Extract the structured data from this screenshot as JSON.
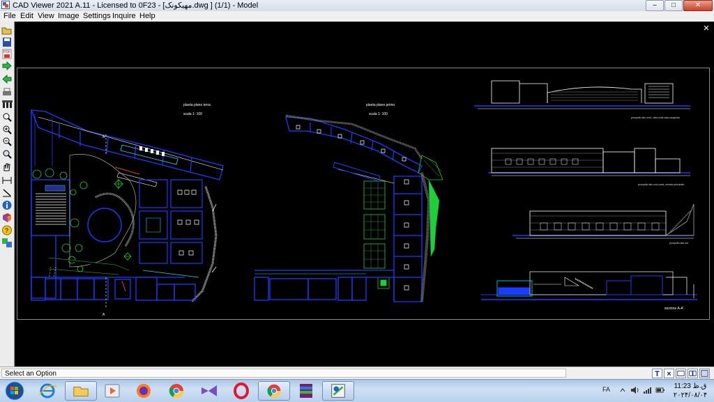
{
  "window": {
    "title": "CAD Viewer 2021 A.11 - Licensed to 0F23 - [مهیکونک.dwg ] (1/1) - Model",
    "min_label": "–",
    "max_label": "□",
    "close_label": "✕"
  },
  "menu": [
    "File",
    "Edit",
    "View",
    "Image",
    "Settings",
    "Inquire",
    "Help"
  ],
  "toolbar": {
    "pdf_label": "PDF",
    "close_drawing_label": "x"
  },
  "drawing": {
    "plan1_title": "planta plano terra",
    "plan1_scale": "scala 1: 100",
    "plan2_title": "planta plano primo",
    "plan2_scale": "scala 1: 100",
    "elev1_caption": "prospetto lato nord, vista sulla sala congressi",
    "elev2_caption": "prospetto lato sud-ovest, entrata principale",
    "elev3_caption": "prospetto lato est",
    "section_caption": "sezione A-A'",
    "axis_mark": "A"
  },
  "status": {
    "text": "Select an Option",
    "text_tool": "T",
    "cancel_tool": "×"
  },
  "tray": {
    "lang": "FA",
    "time": "11:23 ق.ظ",
    "date": "۲۰۲۴/۰۸/۰۴"
  },
  "colors": {
    "canvas": "#000000",
    "walls": "#1a3cff",
    "cyan": "#00e5ff",
    "green": "#1ecf3a",
    "titlebar": "#dfe6ef",
    "taskbar": "#b9d1ec"
  }
}
